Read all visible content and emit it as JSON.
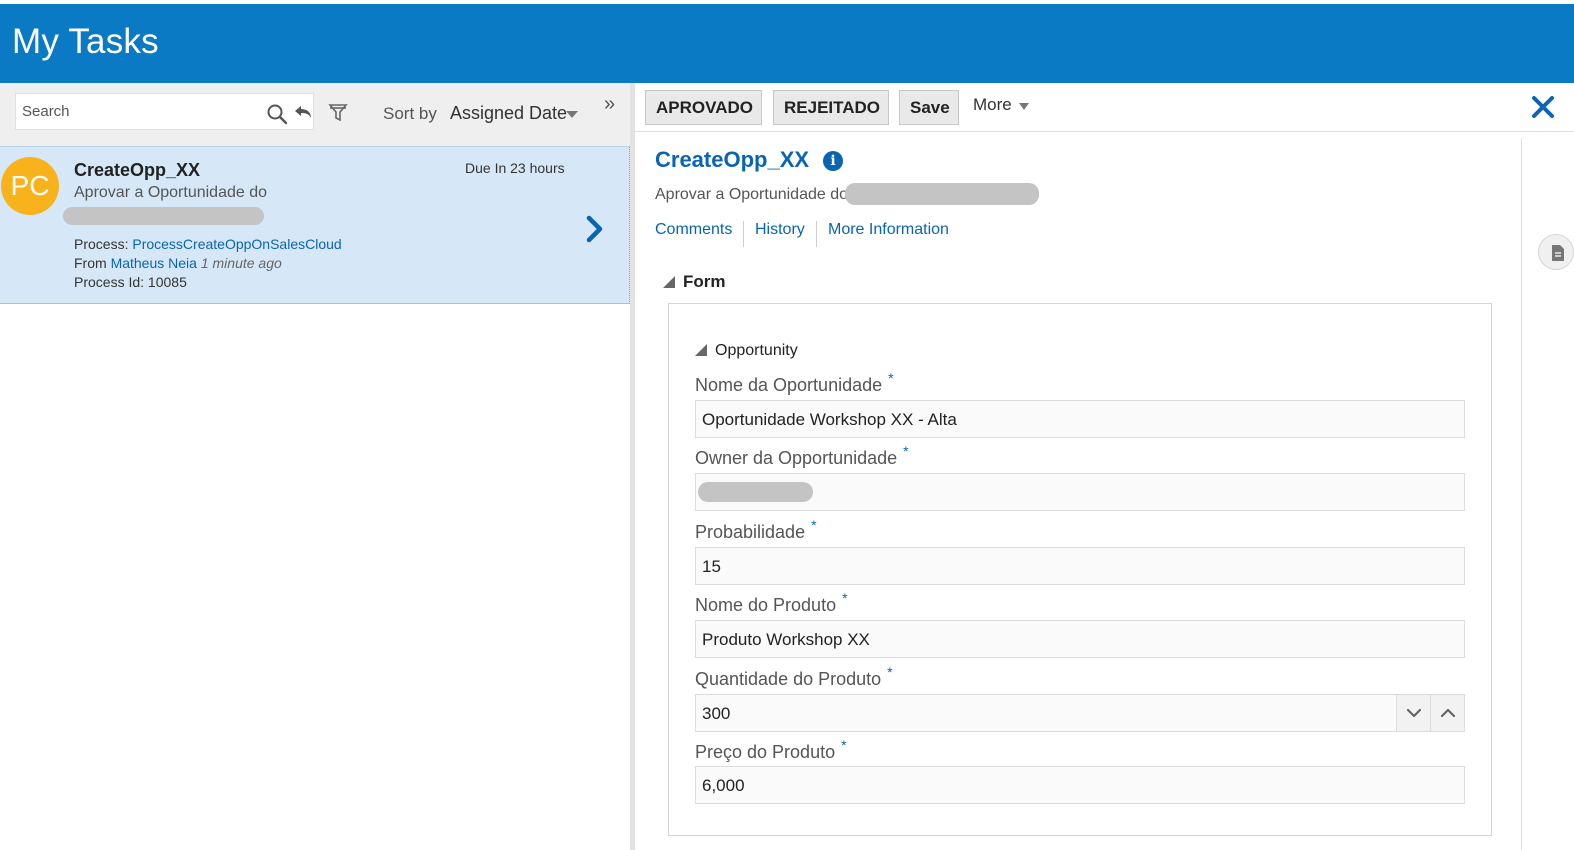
{
  "header": {
    "title": "My Tasks"
  },
  "left": {
    "search": {
      "placeholder": "Search"
    },
    "sort": {
      "label": "Sort by",
      "value": "Assigned Date"
    },
    "task": {
      "avatar_initials": "PC",
      "title": "CreateOpp_XX",
      "due": "Due In 23 hours",
      "description": "Aprovar a Oportunidade do",
      "process_label": "Process:",
      "process_value": "ProcessCreateOppOnSalesCloud",
      "from_label": "From",
      "from_value": "Matheus Neia",
      "from_time": "1 minute ago",
      "process_id_label": "Process Id:",
      "process_id_value": "10085"
    }
  },
  "toolbar": {
    "approve_label": "APROVADO",
    "reject_label": "REJEITADO",
    "save_label": "Save",
    "more_label": "More"
  },
  "detail": {
    "title": "CreateOpp_XX",
    "description": "Aprovar a Oportunidade do",
    "tabs": [
      {
        "label": "Comments"
      },
      {
        "label": "History"
      },
      {
        "label": "More Information"
      }
    ],
    "form_label": "Form",
    "section_label": "Opportunity",
    "required_marker": "*",
    "fields": [
      {
        "label": "Nome da Oportunidade",
        "value": "Oportunidade Workshop  XX - Alta"
      },
      {
        "label": "Owner da Opportunidade",
        "value": ""
      },
      {
        "label": "Probabilidade",
        "value": "15"
      },
      {
        "label": "Nome do Produto",
        "value": "Produto Workshop XX"
      },
      {
        "label": "Quantidade do Produto",
        "value": "300"
      },
      {
        "label": "Preço do Produto",
        "value": "6,000"
      }
    ]
  }
}
